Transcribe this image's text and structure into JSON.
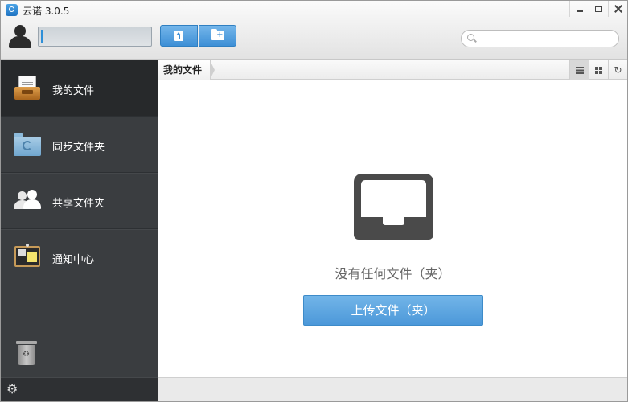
{
  "window": {
    "title": "云诺 3.0.5",
    "controls": [
      "minimize",
      "maximize",
      "close"
    ]
  },
  "toolbar": {
    "user_field_value": "",
    "upload_button_icon": "upload-file-icon",
    "new_folder_button_icon": "new-folder-icon",
    "search": {
      "placeholder": "",
      "value": ""
    }
  },
  "sidebar": {
    "items": [
      {
        "label": "我的文件",
        "icon": "my-files-icon",
        "active": true
      },
      {
        "label": "同步文件夹",
        "icon": "sync-folder-icon",
        "active": false
      },
      {
        "label": "共享文件夹",
        "icon": "shared-folder-icon",
        "active": false
      },
      {
        "label": "通知中心",
        "icon": "notification-board-icon",
        "active": false
      }
    ],
    "trash_icon": "recycle-bin-icon",
    "settings_icon": "gear-icon"
  },
  "main": {
    "breadcrumb": "我的文件",
    "view_modes": [
      "list",
      "grid",
      "refresh"
    ],
    "active_view": "list",
    "empty_message": "没有任何文件（夹）",
    "upload_button_label": "上传文件（夹）"
  },
  "colors": {
    "accent_blue": "#4c98d9",
    "sidebar_bg": "#3a3d40",
    "sidebar_active": "#27292b"
  }
}
